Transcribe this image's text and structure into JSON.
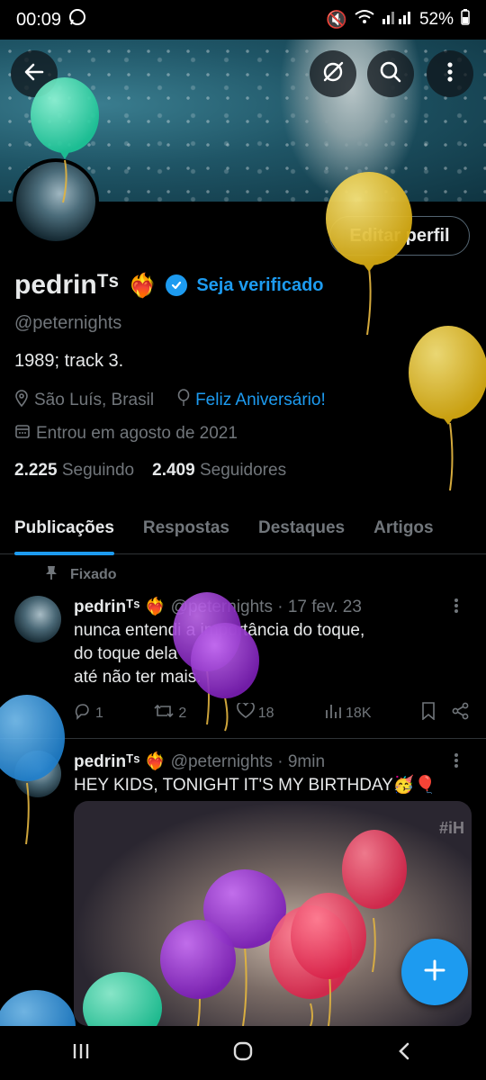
{
  "status_bar": {
    "time": "00:09",
    "battery": "52%"
  },
  "header": {
    "back_icon": "arrow-left-icon",
    "grok_icon": "grok-icon",
    "search_icon": "search-icon",
    "more_icon": "more-vertical-icon"
  },
  "profile": {
    "edit_button": "Editar perfil",
    "display_name": "pedrinᵀˢ",
    "verify_link": "Seja verificado",
    "handle": "@peternights",
    "bio": "1989; track 3.",
    "location": "São Luís, Brasil",
    "birthday_link": "Feliz Aniversário!",
    "joined": "Entrou em agosto de 2021",
    "following_count": "2.225",
    "following_label": "Seguindo",
    "followers_count": "2.409",
    "followers_label": "Seguidores"
  },
  "tabs": [
    {
      "label": "Publicações",
      "active": true
    },
    {
      "label": "Respostas",
      "active": false
    },
    {
      "label": "Destaques",
      "active": false
    },
    {
      "label": "Artigos",
      "active": false
    }
  ],
  "pinned_label": "Fixado",
  "posts": [
    {
      "name": "pedrinᵀˢ",
      "handle": "@peternights",
      "time": "· 17 fev. 23",
      "lines": [
        "nunca entendi a importância do toque,",
        "do toque dela",
        "até não ter mais."
      ],
      "replies": "1",
      "reposts": "2",
      "likes": "18",
      "views": "18K"
    },
    {
      "name": "pedrinᵀˢ",
      "handle": "@peternights",
      "time": "· 9min",
      "text": "HEY KIDS, TONIGHT IT'S MY BIRTHDAY🥳🎈",
      "media_tag": "#iH"
    }
  ],
  "fab_icon": "plus-icon",
  "colors": {
    "accent": "#1d9bf0",
    "background": "#000000",
    "muted": "#71767b"
  }
}
